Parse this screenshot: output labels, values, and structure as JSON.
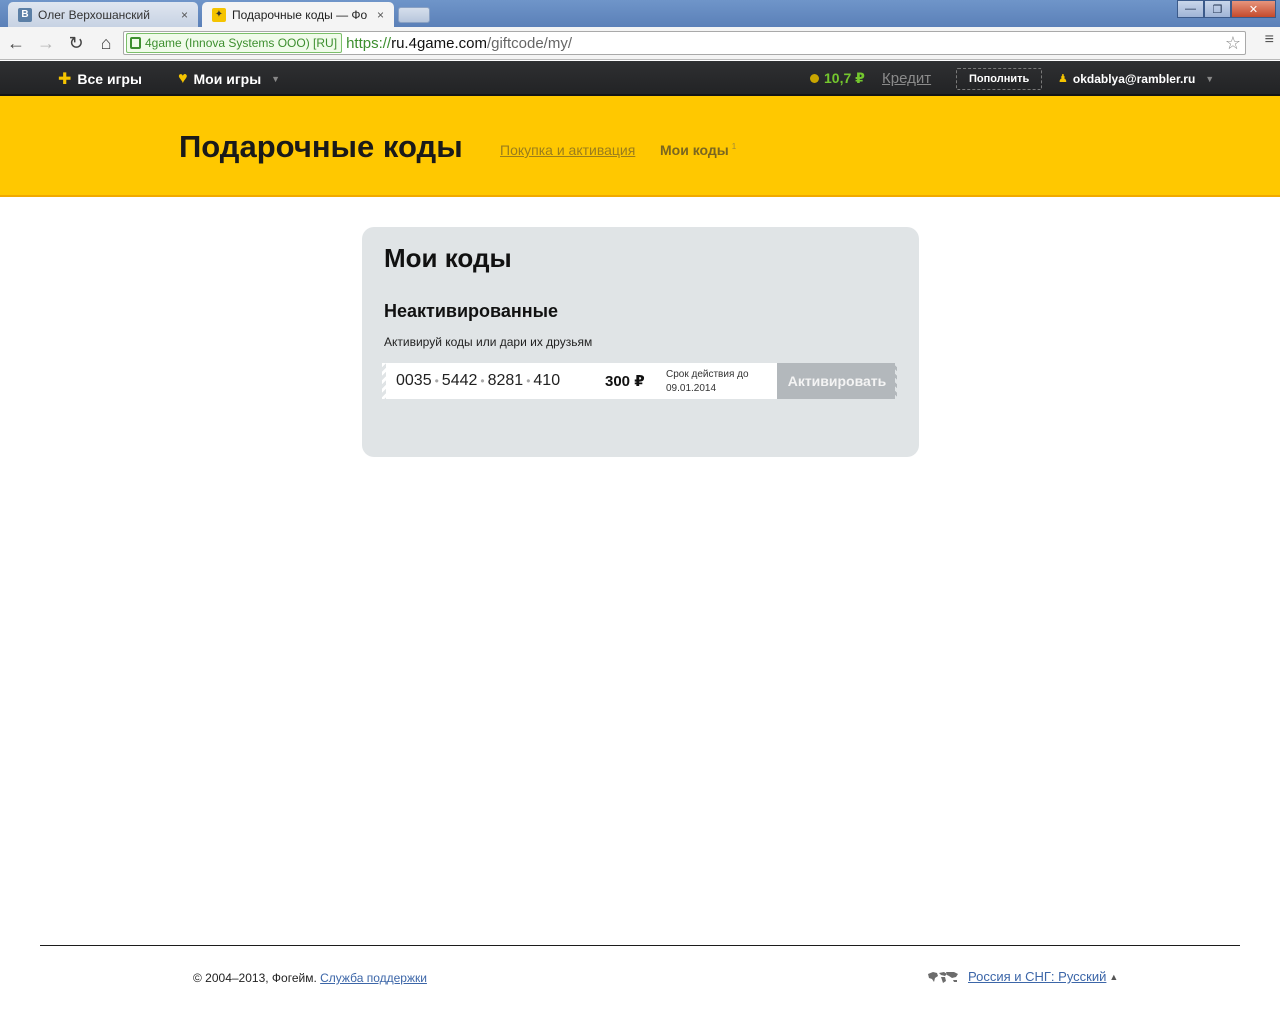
{
  "browser": {
    "tabs": [
      {
        "title": "Олег Верхошанский",
        "favicon": "vk-icon",
        "favicon_text": "B",
        "active": false
      },
      {
        "title": "Подарочные коды — Фо",
        "favicon": "4game-icon",
        "favicon_text": "✦",
        "active": true
      }
    ],
    "tab_close_glyph": "×",
    "window_controls": {
      "minimize": "—",
      "restore": "❐",
      "close": "✕"
    },
    "nav": {
      "back": "←",
      "forward": "→",
      "reload": "↻",
      "home": "⌂"
    },
    "ev_badge": "4game (Innova Systems OOO) [RU]",
    "url_scheme": "https://",
    "url_host": "ru.4game.com",
    "url_path": "/giftcode/my/",
    "star": "☆",
    "menu": "≡"
  },
  "topbar": {
    "all_games": "Все игры",
    "my_games": "Мои игры",
    "balance": "10,7 ₽",
    "credit": "Кредит",
    "topup": "Пополнить",
    "user_email": "okdablya@rambler.ru",
    "dropdown_glyph": "▼",
    "user_glyph": "♟"
  },
  "header": {
    "title": "Подарочные коды",
    "nav_purchase": "Покупка и активация",
    "nav_my_codes": "Мои коды",
    "nav_my_codes_count": "1"
  },
  "card": {
    "title": "Мои коды",
    "section_title": "Неактивированные",
    "description": "Активируй коды или дари их друзьям",
    "codes": [
      {
        "parts": [
          "0035",
          "5442",
          "8281",
          "410"
        ],
        "separator": "•",
        "value": "300 ₽",
        "valid_label": "Срок действия до",
        "valid_date": "09.01.2014",
        "button": "Активировать"
      }
    ]
  },
  "footer": {
    "copyright": "© 2004–2013, Фогейм.",
    "support": "Служба поддержки",
    "region": "Россия и СНГ: Русский",
    "region_arrow": "▲"
  },
  "colors": {
    "brand_yellow": "#ffc800",
    "topbar_dark": "#2a2b2d",
    "balance_green": "#74c72e",
    "card_bg": "#e0e4e6",
    "button_disabled": "#b3b8bc",
    "link_blue": "#3c66a8"
  }
}
